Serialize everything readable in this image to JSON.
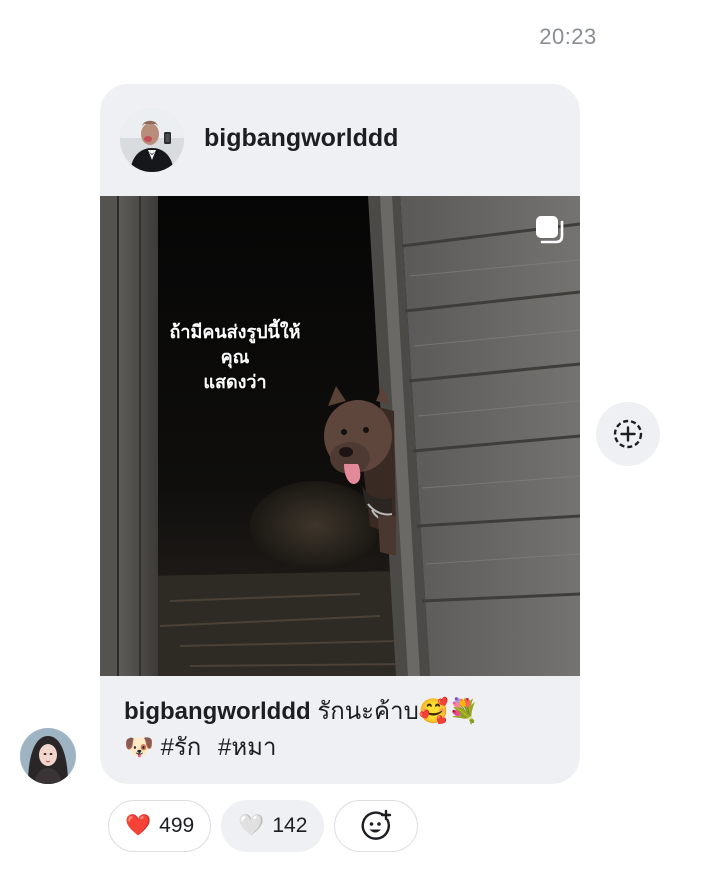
{
  "timestamp": "20:23",
  "post": {
    "username": "bigbangworlddd",
    "overlay_line1": "ถ้ามีคนส่งรูปนี้ให้คุณ",
    "overlay_line2": "แสดงว่า",
    "caption_username": "bigbangworlddd",
    "caption_text": "รักนะค้าบ🥰💐",
    "caption_line2_emoji": "🐶",
    "hashtags": [
      "#รัก",
      "#หมา"
    ]
  },
  "icons": {
    "multi_photo": "carousel-icon",
    "share": "add-story-icon",
    "add_reaction": "add-reaction-icon"
  },
  "reactions": [
    {
      "emoji": "❤️",
      "count": "499"
    },
    {
      "emoji": "🤍",
      "count": "142"
    }
  ],
  "colors": {
    "bubble": "#eff0f4",
    "timestamp": "#8a8d91",
    "heart": "#e8212f"
  }
}
